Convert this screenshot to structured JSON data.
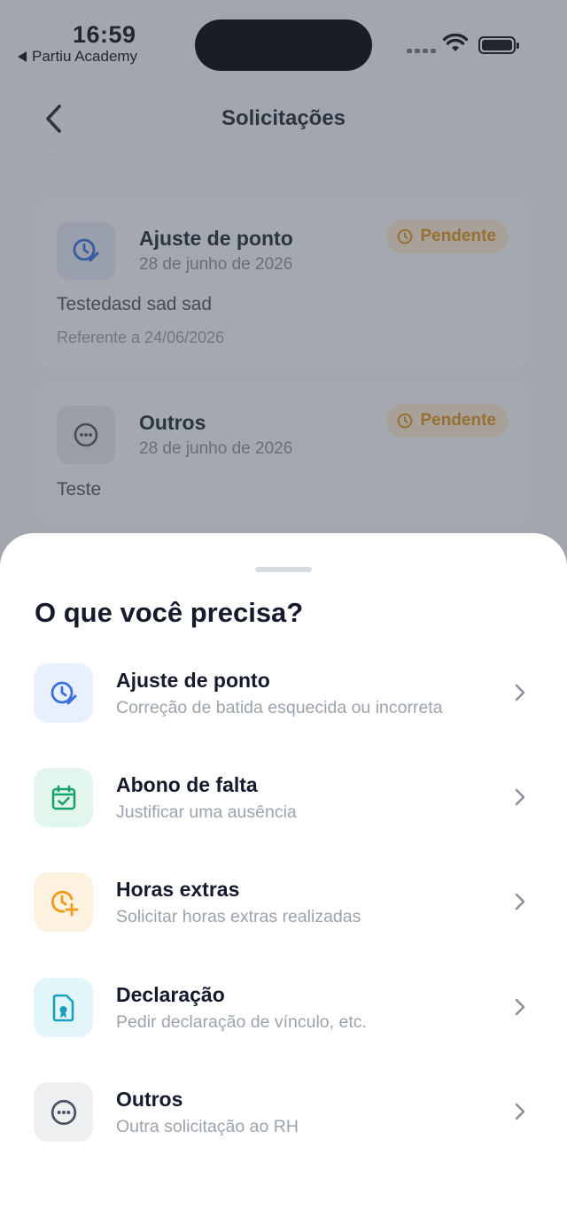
{
  "status_bar": {
    "time": "16:59",
    "back_app": "Partiu Academy"
  },
  "header": {
    "title": "Solicitações"
  },
  "requests": [
    {
      "title": "Ajuste de ponto",
      "date": "28 de junho de 2026",
      "status": "Pendente",
      "description": "Testedasd sad sad",
      "reference": "Referente a 24/06/2026",
      "icon": "clock-edit-icon"
    },
    {
      "title": "Outros",
      "date": "28 de junho de 2026",
      "status": "Pendente",
      "description": "Teste",
      "icon": "more-dots-icon"
    }
  ],
  "sheet": {
    "title": "O que você precisa?",
    "options": [
      {
        "title": "Ajuste de ponto",
        "subtitle": "Correção de batida esquecida ou incorreta",
        "icon": "clock-edit-icon",
        "color": "#3b6fe0",
        "bg": "#e8effd"
      },
      {
        "title": "Abono de falta",
        "subtitle": "Justificar uma ausência",
        "icon": "calendar-check-icon",
        "color": "#16a36a",
        "bg": "#e3f6ee"
      },
      {
        "title": "Horas extras",
        "subtitle": "Solicitar horas extras realizadas",
        "icon": "clock-plus-icon",
        "color": "#f09a1a",
        "bg": "#fdf1df"
      },
      {
        "title": "Declaração",
        "subtitle": "Pedir declaração de vínculo, etc.",
        "icon": "document-badge-icon",
        "color": "#1a9fbf",
        "bg": "#e2f5f9"
      },
      {
        "title": "Outros",
        "subtitle": "Outra solicitação ao RH",
        "icon": "more-dots-icon",
        "color": "#4b5563",
        "bg": "#eeeff1"
      }
    ]
  },
  "colors": {
    "pending": "#e0901c",
    "pending_bg": "#fbecd3",
    "overlay": "#3c4250"
  }
}
